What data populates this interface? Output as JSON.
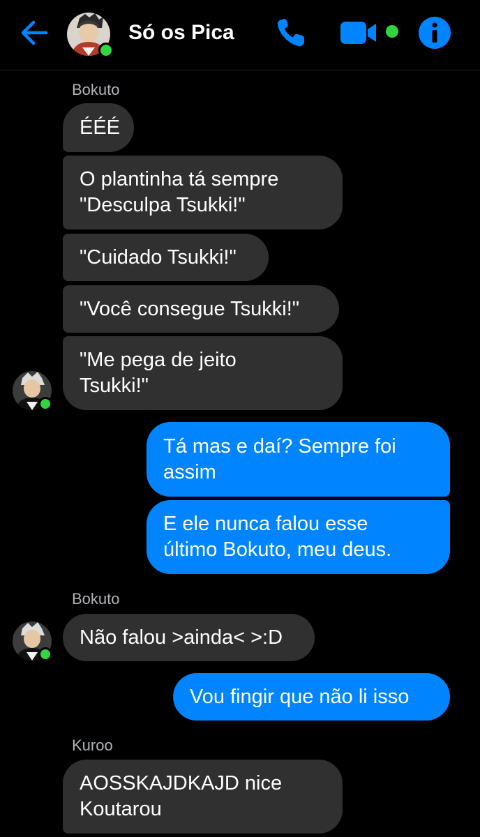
{
  "header": {
    "back_icon": "back-arrow-icon",
    "title": "Só os Pica",
    "call_icon": "phone-icon",
    "video_icon": "video-camera-icon",
    "info_icon": "info-icon",
    "accent_color": "#0084ff",
    "online_color": "#31d63f"
  },
  "messages": [
    {
      "sender": "Bokuto",
      "text": "ÉÉÉ",
      "direction": "incoming"
    },
    {
      "text": "O plantinha tá sempre\n\"Desculpa Tsukki!\"",
      "direction": "incoming"
    },
    {
      "text": "\"Cuidado Tsukki!\"",
      "direction": "incoming"
    },
    {
      "text": "\"Você consegue Tsukki!\"",
      "direction": "incoming"
    },
    {
      "text": "\"Me pega de jeito\nTsukki!\"",
      "direction": "incoming"
    },
    {
      "text": "Tá mas e daí? Sempre foi\nassim",
      "direction": "outgoing"
    },
    {
      "text": "E ele nunca falou esse\núltimo Bokuto, meu deus.",
      "direction": "outgoing"
    },
    {
      "sender": "Bokuto",
      "text": "Não falou >ainda< >:D",
      "direction": "incoming"
    },
    {
      "text": "Vou fingir que não li isso",
      "direction": "outgoing"
    },
    {
      "sender": "Kuroo",
      "text": "AOSSKAJDKAJD nice\nKoutarou",
      "direction": "incoming"
    }
  ]
}
